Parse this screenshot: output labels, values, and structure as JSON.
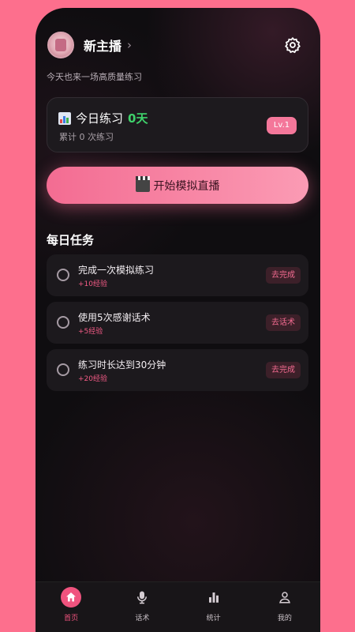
{
  "header": {
    "username": "新主播",
    "subtitle": "今天也来一场高质量练习"
  },
  "practice_card": {
    "title": "今日练习",
    "days": "0天",
    "total": "累计 0 次练习",
    "level": "Lv.1"
  },
  "start_button": {
    "label": "开始模拟直播"
  },
  "daily_tasks": {
    "title": "每日任务",
    "items": [
      {
        "title": "完成一次模拟练习",
        "xp": "+10经验",
        "action": "去完成"
      },
      {
        "title": "使用5次感谢话术",
        "xp": "+5经验",
        "action": "去话术"
      },
      {
        "title": "练习时长达到30分钟",
        "xp": "+20经验",
        "action": "去完成"
      }
    ]
  },
  "tabs": [
    {
      "label": "首页",
      "icon": "home-icon",
      "active": true
    },
    {
      "label": "话术",
      "icon": "microphone-icon",
      "active": false
    },
    {
      "label": "统计",
      "icon": "bar-chart-icon",
      "active": false
    },
    {
      "label": "我的",
      "icon": "user-icon",
      "active": false
    }
  ],
  "colors": {
    "accent": "#f0537e",
    "success": "#3fd26b",
    "background": "#0f0d10",
    "frame": "#fd6f8d"
  }
}
